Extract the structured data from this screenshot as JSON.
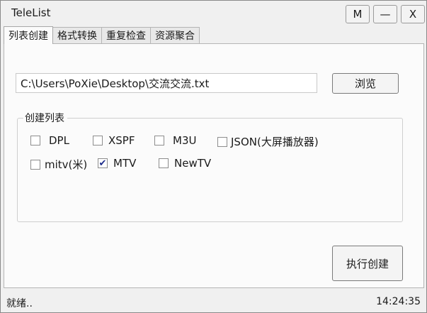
{
  "window": {
    "title": "TeleList",
    "buttons": {
      "m": "M",
      "minimize": "—",
      "close": "X"
    }
  },
  "tabs": [
    {
      "label": "列表创建",
      "active": true
    },
    {
      "label": "格式转换",
      "active": false
    },
    {
      "label": "重复检查",
      "active": false
    },
    {
      "label": "资源聚合",
      "active": false
    }
  ],
  "file": {
    "path": "C:\\Users\\PoXie\\Desktop\\交流交流.txt",
    "browse_label": "浏览"
  },
  "group": {
    "title": "创建列表",
    "options": [
      {
        "label": "DPL",
        "checked": false
      },
      {
        "label": "XSPF",
        "checked": false
      },
      {
        "label": "M3U",
        "checked": false
      },
      {
        "label": "JSON(大屏播放器)",
        "checked": false
      },
      {
        "label": "mitv(米)",
        "checked": false
      },
      {
        "label": "MTV",
        "checked": true
      },
      {
        "label": "NewTV",
        "checked": false
      }
    ]
  },
  "actions": {
    "execute_label": "执行创建"
  },
  "statusbar": {
    "status": "就绪..",
    "time": "14:24:35"
  },
  "colors": {
    "check_mark": "#1b2a8a"
  }
}
